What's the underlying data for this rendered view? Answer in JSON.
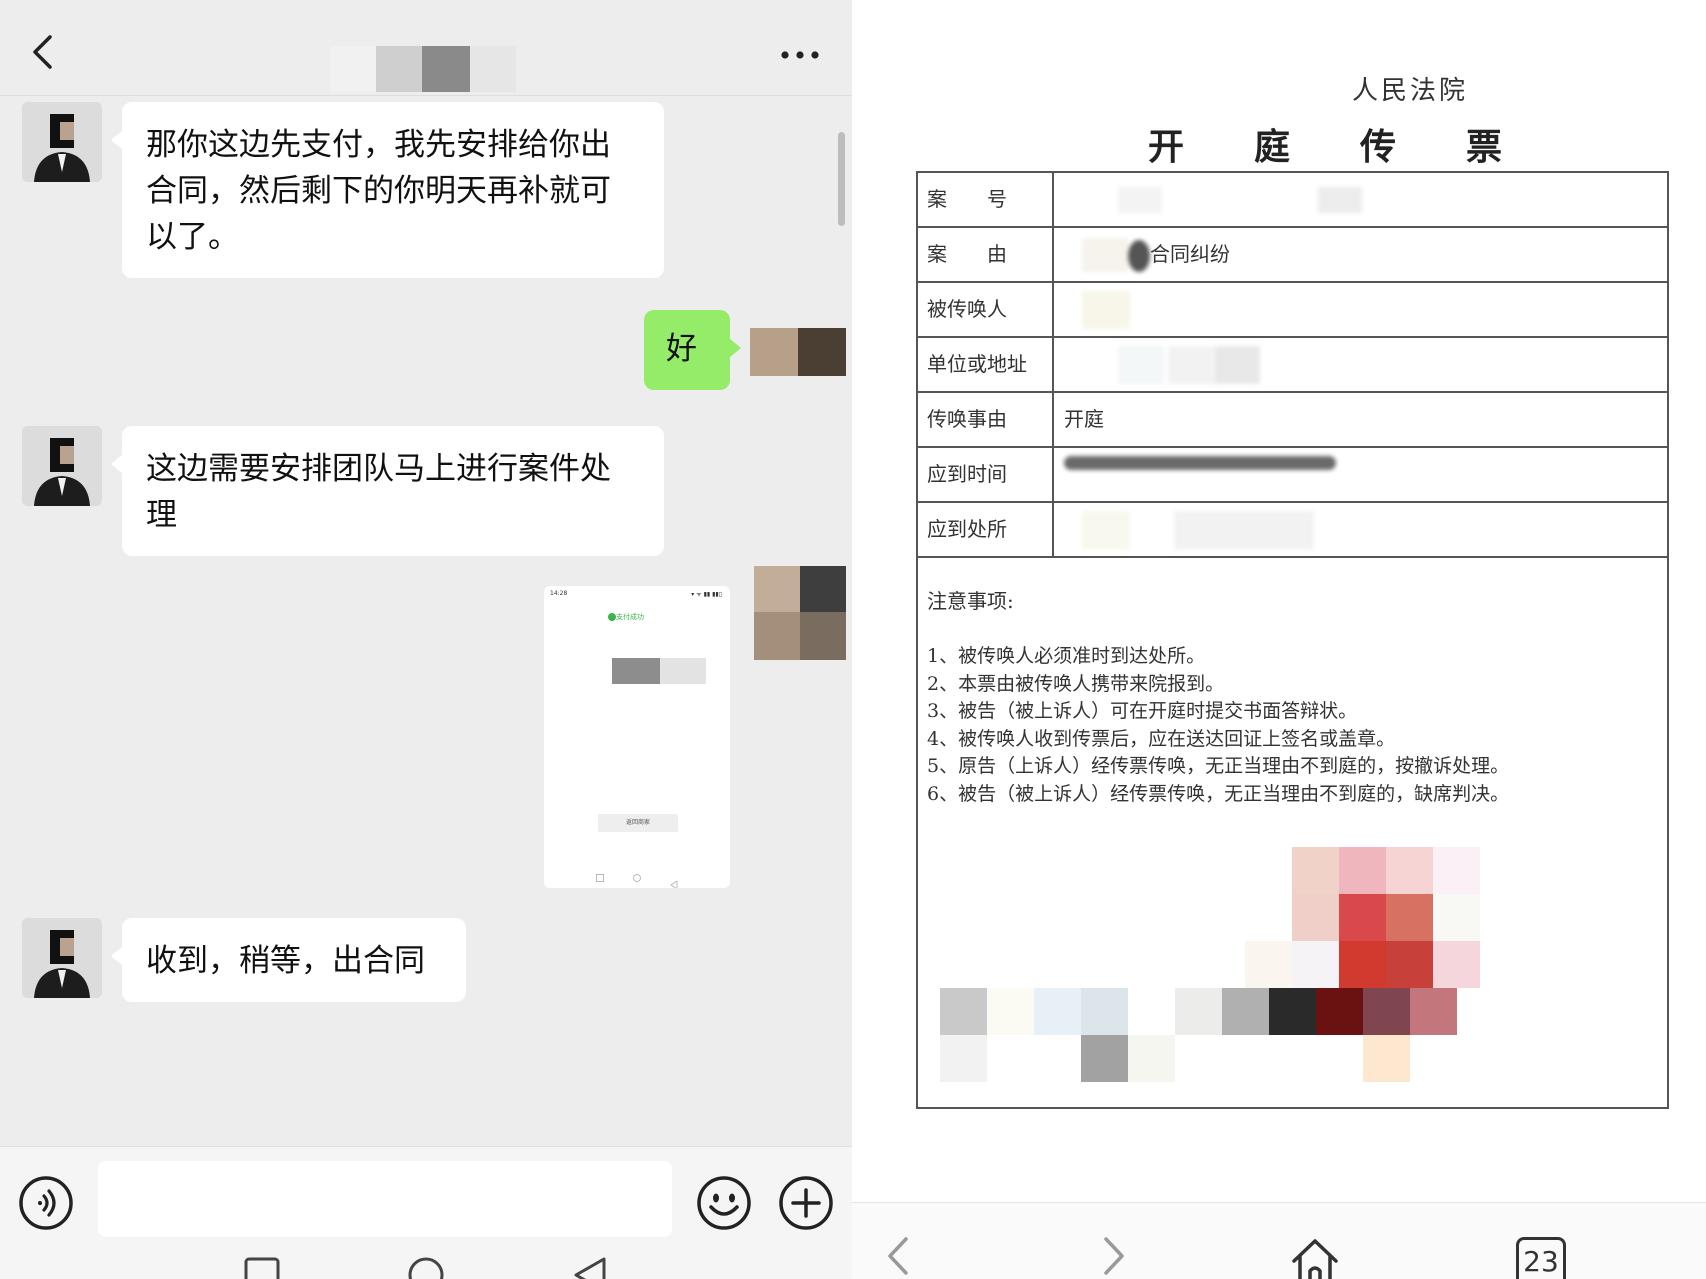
{
  "chat": {
    "messages": [
      {
        "from": "contact",
        "text_lines": [
          "那你这边先支付，我先安排给你出",
          "合同，然后剩下的你明天再补就可",
          "以了。"
        ]
      },
      {
        "from": "me",
        "text": "好"
      },
      {
        "from": "contact",
        "text_lines": [
          "这边需要安排团队马上进行案件处",
          "理"
        ]
      },
      {
        "from": "me",
        "type": "image",
        "screenshot": {
          "status_time": "14:28",
          "status_right": "▾ ᯤ ▮▮ ▮▮▯",
          "success_text": "支付成功",
          "button_label": "返回商家"
        }
      },
      {
        "from": "contact",
        "text": "收到，稍等，出合同"
      }
    ],
    "input_placeholder": ""
  },
  "document": {
    "court": "人民法院",
    "title_chars": [
      "开",
      "庭",
      "传",
      "票"
    ],
    "rows": [
      {
        "label": "案　　号",
        "value": ""
      },
      {
        "label": "案　　由",
        "value": "合同纠纷"
      },
      {
        "label": "被传唤人",
        "value": ""
      },
      {
        "label": "单位或地址",
        "value": ""
      },
      {
        "label": "传唤事由",
        "value": "开庭"
      },
      {
        "label": "应到时间",
        "value": ""
      },
      {
        "label": "应到处所",
        "value": ""
      }
    ],
    "notes_title": "注意事项:",
    "notes": [
      "1、被传唤人必须准时到达处所。",
      "2、本票由被传唤人携带来院报到。",
      "3、被告（被上诉人）可在开庭时提交书面答辩状。",
      "4、被传唤人收到传票后，应在送达回证上签名或盖章。",
      "5、原告（上诉人）经传票传唤，无正当理由不到庭的，按撤诉处理。",
      "6、被告（被上诉人）经传票传唤，无正当理由不到庭的，缺席判决。"
    ],
    "tab_count": "23"
  },
  "colors": {
    "chat_bg": "#ededed",
    "outgoing_bubble": "#95ec69",
    "incoming_bubble": "#ffffff",
    "form_border": "#555555"
  }
}
